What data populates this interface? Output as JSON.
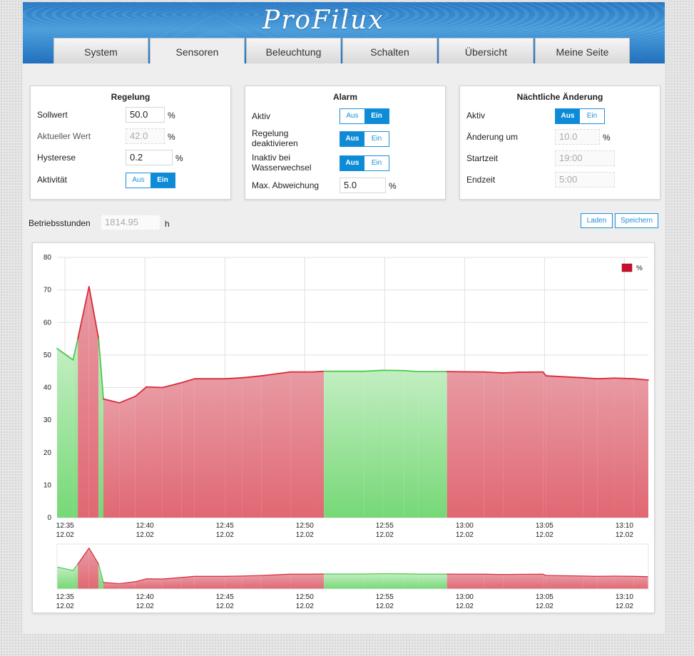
{
  "header": {
    "logo_text": "ProFilux"
  },
  "tabs": [
    {
      "label": "System",
      "active": false
    },
    {
      "label": "Sensoren",
      "active": true
    },
    {
      "label": "Beleuchtung",
      "active": false
    },
    {
      "label": "Schalten",
      "active": false
    },
    {
      "label": "Übersicht",
      "active": false
    },
    {
      "label": "Meine Seite",
      "active": false
    }
  ],
  "regelung": {
    "title": "Regelung",
    "sollwert_label": "Sollwert",
    "sollwert_value": "50.0",
    "sollwert_unit": "%",
    "aktuell_label": "Aktueller Wert",
    "aktuell_value": "42.0",
    "aktuell_unit": "%",
    "hysterese_label": "Hysterese",
    "hysterese_value": "0.2",
    "hysterese_unit": "%",
    "aktivitaet_label": "Aktivität",
    "aktivitaet_off": "Aus",
    "aktivitaet_on": "Ein",
    "aktivitaet_state": "Ein"
  },
  "alarm": {
    "title": "Alarm",
    "aktiv_label": "Aktiv",
    "aktiv_off": "Aus",
    "aktiv_on": "Ein",
    "aktiv_state": "Ein",
    "regelung_label_1": "Regelung",
    "regelung_label_2": "deaktivieren",
    "regelung_off": "Aus",
    "regelung_on": "Ein",
    "regelung_state": "Aus",
    "inaktiv_label_1": "Inaktiv bei",
    "inaktiv_label_2": "Wasserwechsel",
    "inaktiv_off": "Aus",
    "inaktiv_on": "Ein",
    "inaktiv_state": "Aus",
    "abweichung_label": "Max. Abweichung",
    "abweichung_value": "5.0",
    "abweichung_unit": "%"
  },
  "nacht": {
    "title": "Nächtliche Änderung",
    "aktiv_label": "Aktiv",
    "aktiv_off": "Aus",
    "aktiv_on": "Ein",
    "aktiv_state": "Aus",
    "aenderung_label": "Änderung um",
    "aenderung_value": "10.0",
    "aenderung_unit": "%",
    "start_label": "Startzeit",
    "start_value": "19:00",
    "end_label": "Endzeit",
    "end_value": "5:00"
  },
  "betrieb": {
    "label": "Betriebsstunden",
    "value": "1814.95",
    "unit": "h"
  },
  "buttons": {
    "laden": "Laden",
    "speichern": "Speichern"
  },
  "chart_data": {
    "type": "area",
    "ylim": [
      0,
      80
    ],
    "yticks": [
      0,
      10,
      20,
      30,
      40,
      50,
      60,
      70,
      80
    ],
    "xlim_minutes": [
      34.5,
      71.5
    ],
    "xticks": [
      {
        "m": 35,
        "time": "12:35",
        "date": "12.02"
      },
      {
        "m": 40,
        "time": "12:40",
        "date": "12.02"
      },
      {
        "m": 45,
        "time": "12:45",
        "date": "12.02"
      },
      {
        "m": 50,
        "time": "12:50",
        "date": "12.02"
      },
      {
        "m": 55,
        "time": "12:55",
        "date": "12.02"
      },
      {
        "m": 60,
        "time": "13:00",
        "date": "12.02"
      },
      {
        "m": 65,
        "time": "13:05",
        "date": "12.02"
      },
      {
        "m": 70,
        "time": "13:10",
        "date": "12.02"
      }
    ],
    "legend": [
      {
        "name": "%",
        "color": "#c8102e"
      }
    ],
    "colors": {
      "on": "#4cc94c",
      "off": "#d92a3a"
    },
    "points": [
      {
        "m": 34.5,
        "v": 52,
        "s": 1
      },
      {
        "m": 35.5,
        "v": 48.5,
        "s": 1
      },
      {
        "m": 35.8,
        "v": 55,
        "s": 0
      },
      {
        "m": 36.5,
        "v": 71,
        "s": 0
      },
      {
        "m": 37.1,
        "v": 55,
        "s": 1
      },
      {
        "m": 37.4,
        "v": 36.5,
        "s": 0
      },
      {
        "m": 38.4,
        "v": 35.3,
        "s": 0
      },
      {
        "m": 39.4,
        "v": 37.3,
        "s": 0
      },
      {
        "m": 40.1,
        "v": 40.2,
        "s": 0
      },
      {
        "m": 41.1,
        "v": 40,
        "s": 0
      },
      {
        "m": 42.3,
        "v": 41.5,
        "s": 0
      },
      {
        "m": 43.1,
        "v": 42.7,
        "s": 0
      },
      {
        "m": 45,
        "v": 42.7,
        "s": 0
      },
      {
        "m": 46.1,
        "v": 43,
        "s": 0
      },
      {
        "m": 47.3,
        "v": 43.6,
        "s": 0
      },
      {
        "m": 49.1,
        "v": 44.8,
        "s": 0
      },
      {
        "m": 50.5,
        "v": 44.8,
        "s": 0
      },
      {
        "m": 51.2,
        "v": 45,
        "s": 1
      },
      {
        "m": 53.7,
        "v": 45,
        "s": 1
      },
      {
        "m": 54.9,
        "v": 45.3,
        "s": 1
      },
      {
        "m": 56.2,
        "v": 45.2,
        "s": 1
      },
      {
        "m": 57.1,
        "v": 44.9,
        "s": 1
      },
      {
        "m": 58.9,
        "v": 44.9,
        "s": 0
      },
      {
        "m": 61.2,
        "v": 44.8,
        "s": 0
      },
      {
        "m": 62.4,
        "v": 44.5,
        "s": 0
      },
      {
        "m": 63.4,
        "v": 44.7,
        "s": 0
      },
      {
        "m": 64.9,
        "v": 44.8,
        "s": 0
      },
      {
        "m": 65.1,
        "v": 43.6,
        "s": 0
      },
      {
        "m": 67.4,
        "v": 43,
        "s": 0
      },
      {
        "m": 68.3,
        "v": 42.7,
        "s": 0
      },
      {
        "m": 69.4,
        "v": 42.9,
        "s": 0
      },
      {
        "m": 70.6,
        "v": 42.7,
        "s": 0
      },
      {
        "m": 71.5,
        "v": 42.3,
        "s": 0
      }
    ]
  }
}
